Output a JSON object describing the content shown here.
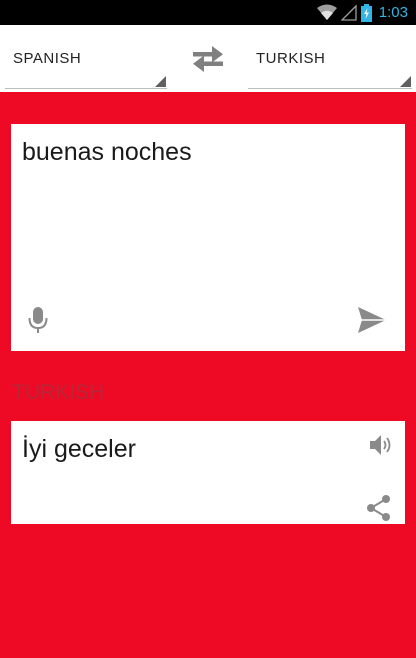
{
  "status_bar": {
    "time": "1:03",
    "icons": [
      "wifi-icon",
      "signal-icon",
      "battery-charging-icon"
    ]
  },
  "language_bar": {
    "source_language": "SPANISH",
    "target_language": "TURKISH",
    "swap_icon": "swap-arrows-icon"
  },
  "input": {
    "text": "buenas noches",
    "mic_icon": "microphone-icon",
    "send_icon": "send-icon"
  },
  "output": {
    "language_label": "TURKISH",
    "text": "İyi geceler",
    "speaker_icon": "speaker-icon",
    "share_icon": "share-icon"
  },
  "colors": {
    "background": "#ee0a24",
    "status_time": "#33b5e5",
    "target_label": "#b7263a"
  }
}
